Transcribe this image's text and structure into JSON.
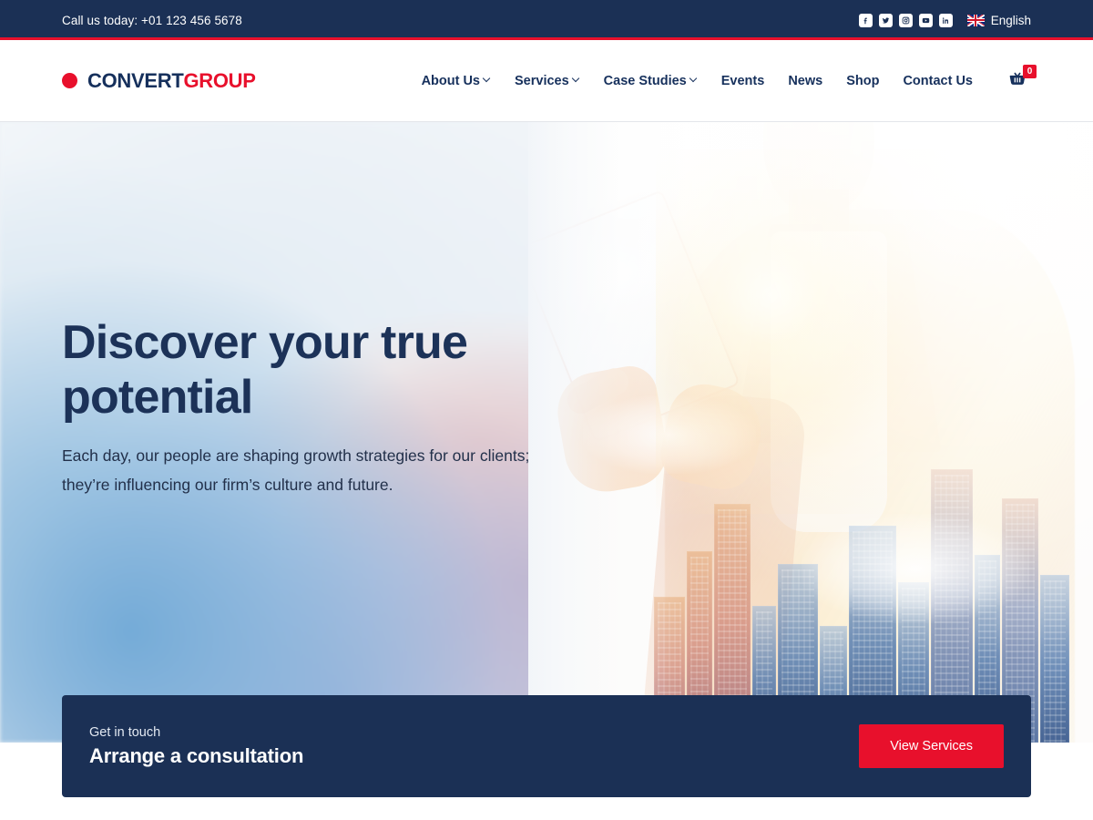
{
  "topbar": {
    "phone": "Call us today: +01 123 456 5678",
    "social": [
      {
        "name": "facebook-icon",
        "glyph": "f"
      },
      {
        "name": "twitter-icon",
        "glyph": "t"
      },
      {
        "name": "instagram-icon",
        "glyph": "o"
      },
      {
        "name": "youtube-icon",
        "glyph": "y"
      },
      {
        "name": "linkedin-icon",
        "glyph": "in"
      }
    ],
    "language": "English",
    "flag": "uk-flag-icon",
    "bg_color": "#1b3055",
    "accent_color": "#e8102c"
  },
  "header": {
    "logo": {
      "primary": "CONVERT",
      "secondary": "GROUP",
      "dot_color": "#e8102c"
    },
    "nav": [
      {
        "label": "About Us",
        "has_dropdown": true
      },
      {
        "label": "Services",
        "has_dropdown": true
      },
      {
        "label": "Case Studies",
        "has_dropdown": true
      },
      {
        "label": "Events",
        "has_dropdown": false
      },
      {
        "label": "News",
        "has_dropdown": false
      },
      {
        "label": "Shop",
        "has_dropdown": false
      },
      {
        "label": "Contact Us",
        "has_dropdown": false
      }
    ],
    "cart": {
      "icon": "shopping-basket-icon",
      "count": "0"
    }
  },
  "hero": {
    "title": "Discover your true potential",
    "subtitle": "Each day, our people are shaping growth strategies for our clients; they’re influencing our firm’s culture and future.",
    "image_alt": "businessman-with-tablet-double-exposure-cityscape",
    "title_color": "#1c3258"
  },
  "cta": {
    "eyebrow": "Get in touch",
    "title": "Arrange a consultation",
    "button_label": "View Services",
    "bg_color": "#1b3055",
    "button_color": "#e8102c"
  }
}
